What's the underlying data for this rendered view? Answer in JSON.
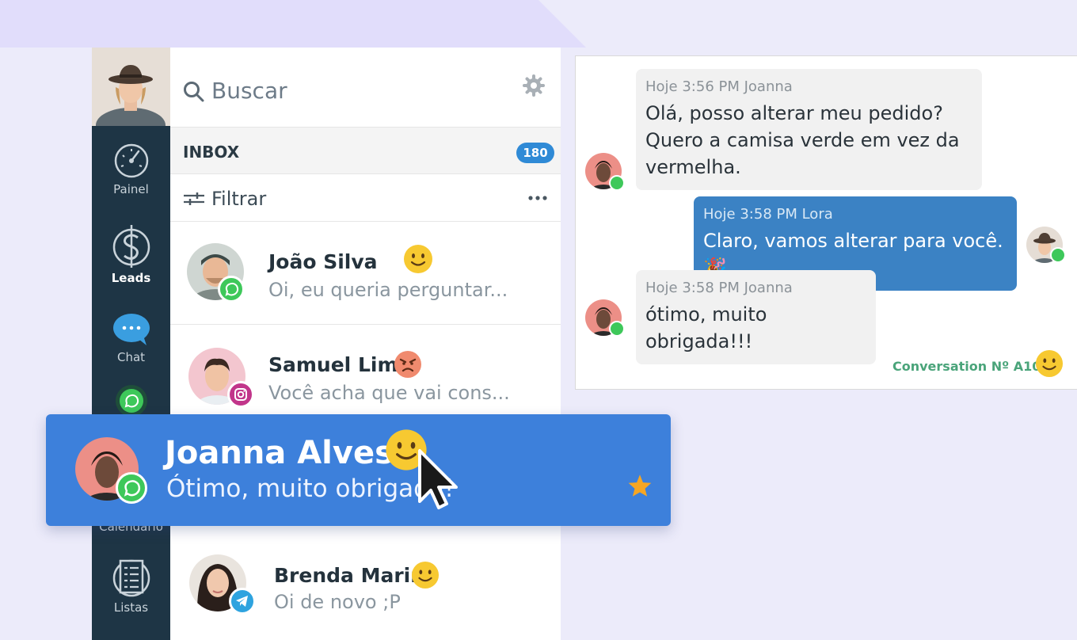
{
  "rail": {
    "items": [
      {
        "label": "Painel",
        "icon": "dashboard-gauge-icon"
      },
      {
        "label": "Leads",
        "icon": "dollar-icon"
      },
      {
        "label": "Chat",
        "icon": "chat-bubble-icon"
      },
      {
        "label": "Calendário",
        "icon": "whatsapp-icon"
      },
      {
        "label": "Listas",
        "icon": "list-icon"
      }
    ]
  },
  "search": {
    "placeholder": "Buscar"
  },
  "inbox": {
    "title": "INBOX",
    "count": "180"
  },
  "filter": {
    "label": "Filtrar"
  },
  "contacts": [
    {
      "name": "João Silva",
      "message": "Oi, eu queria perguntar...",
      "channel": "whatsapp-icon",
      "mood": "smile-emoji"
    },
    {
      "name": "Samuel Lima",
      "message": "Você acha que vai cons...",
      "channel": "instagram-icon",
      "mood": "angry-emoji"
    },
    {
      "name": "Brenda Marini",
      "message": "Oi de novo ;P",
      "channel": "telegram-icon",
      "mood": "smile-emoji"
    }
  ],
  "highlight": {
    "name": "Joanna Alves",
    "message": "Ótimo, muito obrigada!",
    "channel": "whatsapp-icon",
    "mood": "smile-emoji",
    "starred": true
  },
  "chat": {
    "messages": [
      {
        "meta": "Hoje 3:56 PM Joanna",
        "text": "Olá, posso alterar meu pedido? Quero a camisa verde em vez da vermelha.",
        "direction": "in"
      },
      {
        "meta": "Hoje 3:58 PM Lora",
        "text": "Claro, vamos alterar para você.🎉",
        "direction": "out"
      },
      {
        "meta": "Hoje 3:58 PM Joanna",
        "text": "ótimo, muito obrigada!!!",
        "direction": "in"
      }
    ],
    "conversation_label": "Conversation Nº A100"
  },
  "colors": {
    "rail": "#1e3545",
    "accent": "#3d80db",
    "badge": "#2f8ad6",
    "whatsapp": "#3ec85a",
    "emoji": "#f7c931"
  }
}
